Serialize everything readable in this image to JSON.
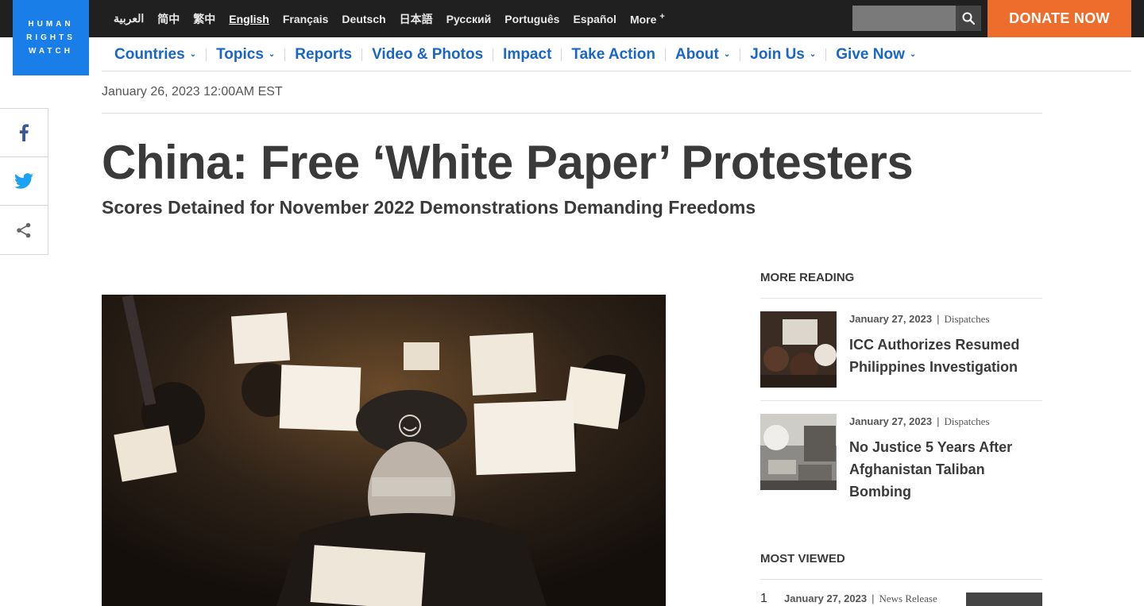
{
  "logo": {
    "line1": "HUMAN",
    "line2": "RIGHTS",
    "line3": "WATCH"
  },
  "languages": [
    {
      "label": "العربية",
      "active": false
    },
    {
      "label": "简中",
      "active": false
    },
    {
      "label": "繁中",
      "active": false
    },
    {
      "label": "English",
      "active": true
    },
    {
      "label": "Français",
      "active": false
    },
    {
      "label": "Deutsch",
      "active": false
    },
    {
      "label": "日本語",
      "active": false
    },
    {
      "label": "Русский",
      "active": false
    },
    {
      "label": "Português",
      "active": false
    },
    {
      "label": "Español",
      "active": false
    }
  ],
  "more_label": "More",
  "more_symbol": "+",
  "search": {
    "placeholder": "",
    "icon": "search-icon"
  },
  "donate_label": "DONATE NOW",
  "nav": [
    {
      "label": "Countries",
      "dropdown": true
    },
    {
      "label": "Topics",
      "dropdown": true
    },
    {
      "label": "Reports",
      "dropdown": false
    },
    {
      "label": "Video & Photos",
      "dropdown": false
    },
    {
      "label": "Impact",
      "dropdown": false
    },
    {
      "label": "Take Action",
      "dropdown": false
    },
    {
      "label": "About",
      "dropdown": true
    },
    {
      "label": "Join Us",
      "dropdown": true
    },
    {
      "label": "Give Now",
      "dropdown": true
    }
  ],
  "share_icons": [
    "facebook-icon",
    "twitter-icon",
    "share-icon"
  ],
  "article": {
    "date": "January 26, 2023 12:00AM EST",
    "title": "China: Free ‘White Paper’ Protesters",
    "subtitle": "Scores Detained for November 2022 Demonstrations Demanding Freedoms"
  },
  "more_reading": {
    "heading": "MORE READING",
    "items": [
      {
        "date": "January 27, 2023",
        "category": "Dispatches",
        "title": "ICC Authorizes Resumed Philippines Investigation"
      },
      {
        "date": "January 27, 2023",
        "category": "Dispatches",
        "title": "No Justice 5 Years After Afghanistan Taliban Bombing"
      }
    ]
  },
  "most_viewed": {
    "heading": "MOST VIEWED",
    "items": [
      {
        "rank": "1",
        "date": "January 27, 2023",
        "category": "News Release"
      }
    ]
  },
  "colors": {
    "brand_blue": "#1a7ee8",
    "nav_blue": "#1a66c8",
    "donate_orange": "#ef6d2c",
    "topbar": "#202020"
  }
}
